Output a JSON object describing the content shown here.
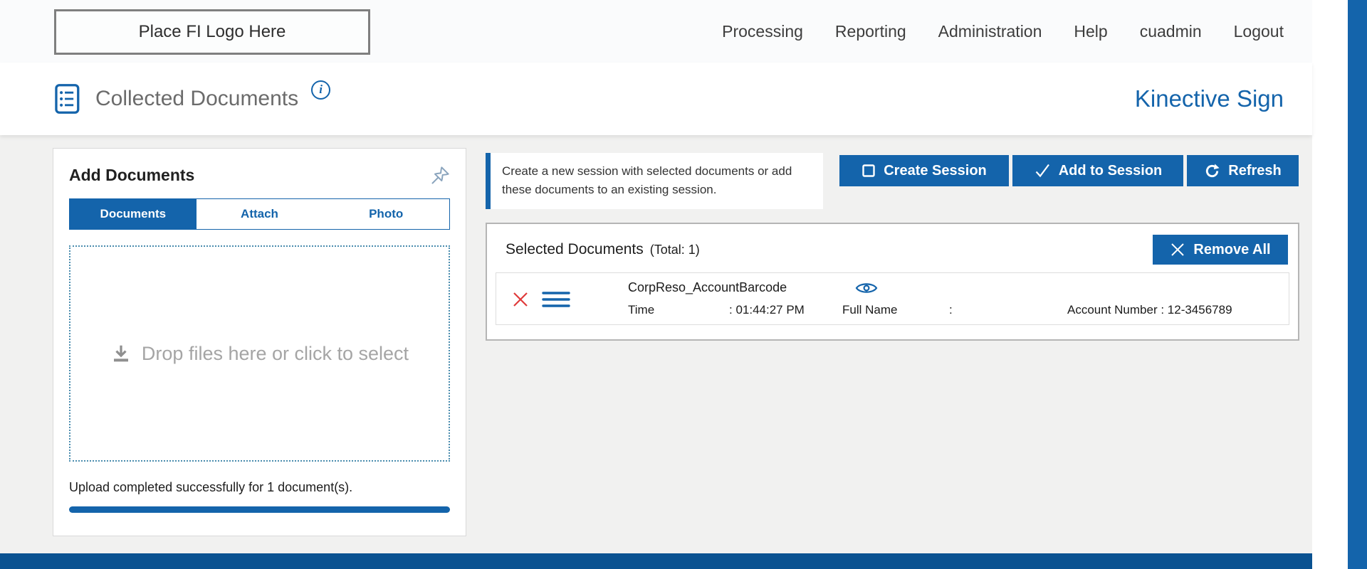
{
  "colors": {
    "primary": "#1464ab",
    "footer": "#0a5291",
    "main_background": "#f1f1f0"
  },
  "header": {
    "logo_text": "Place FI Logo Here",
    "nav": [
      "Processing",
      "Reporting",
      "Administration",
      "Help",
      "cuadmin",
      "Logout"
    ]
  },
  "page_bar": {
    "title": "Collected Documents",
    "info_glyph": "i",
    "brand": "Kinective Sign"
  },
  "add_documents": {
    "title": "Add Documents",
    "tabs": [
      "Documents",
      "Attach",
      "Photo"
    ],
    "active_tab": "Documents",
    "dropzone_text": "Drop files here or click to select",
    "status_text": "Upload completed successfully for 1 document(s)."
  },
  "session_actions": {
    "info_text": "Create a new session with selected documents or add these documents to an existing session.",
    "create_label": "Create Session",
    "add_label": "Add to Session",
    "refresh_label": "Refresh"
  },
  "selected_documents": {
    "title": "Selected Documents",
    "total_label": "(Total: 1)",
    "remove_all_label": "Remove All",
    "rows": [
      {
        "name": "CorpReso_AccountBarcode",
        "time_label": "Time",
        "time_value": ": 01:44:27 PM",
        "full_name_label": "Full Name",
        "full_name_value": ":",
        "account_text": "Account Number : 12-3456789"
      }
    ]
  }
}
